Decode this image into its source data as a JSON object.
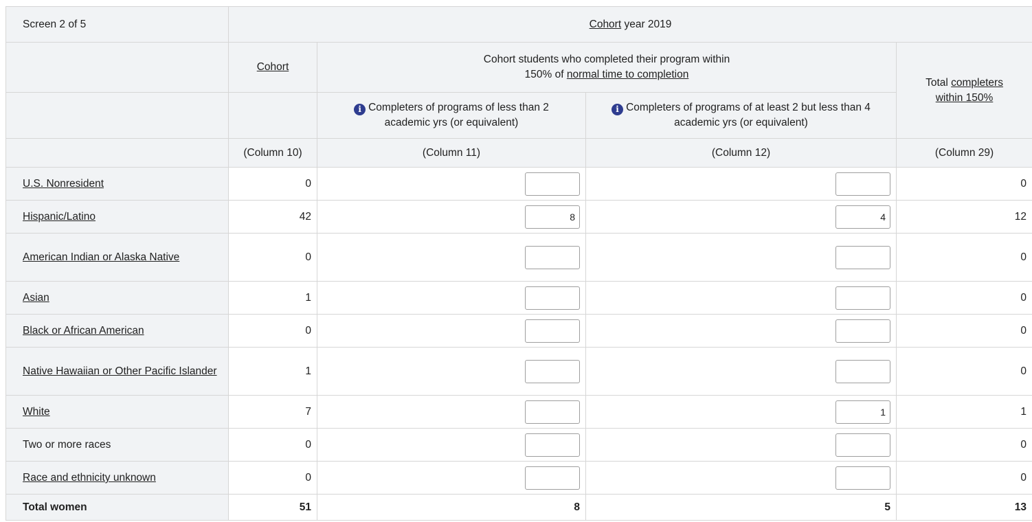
{
  "header": {
    "screen_label": "Screen 2 of 5",
    "cohort_year_link": "Cohort",
    "cohort_year_text": " year 2019",
    "cohort_col": "Cohort",
    "completed_line1": "Cohort students who completed their program within",
    "completed_line2_prefix": "150% of ",
    "completed_line2_link": "normal time to completion",
    "total_prefix": "Total ",
    "total_link_a": "completers",
    "total_link_b": "within 150%",
    "sub_lt2": "Completers of programs of less than 2 academic yrs (or equivalent)",
    "sub_2to4": "Completers of programs of at least 2 but less than 4 academic yrs (or equivalent)",
    "col10": "(Column 10)",
    "col11": "(Column 11)",
    "col12": "(Column 12)",
    "col29": "(Column 29)"
  },
  "rows": [
    {
      "label": "U.S. Nonresident",
      "cohort": "0",
      "c11": "",
      "c12": "",
      "total": "0"
    },
    {
      "label": "Hispanic/Latino",
      "cohort": "42",
      "c11": "8",
      "c12": "4",
      "total": "12"
    },
    {
      "label": "American Indian or Alaska Native",
      "cohort": "0",
      "c11": "",
      "c12": "",
      "total": "0"
    },
    {
      "label": "Asian",
      "cohort": "1",
      "c11": "",
      "c12": "",
      "total": "0"
    },
    {
      "label": "Black or African American",
      "cohort": "0",
      "c11": "",
      "c12": "",
      "total": "0"
    },
    {
      "label": "Native Hawaiian or Other Pacific Islander",
      "cohort": "1",
      "c11": "",
      "c12": "",
      "total": "0"
    },
    {
      "label": "White",
      "cohort": "7",
      "c11": "",
      "c12": "1",
      "total": "1"
    },
    {
      "label": "Two or more races",
      "cohort": "0",
      "c11": "",
      "c12": "",
      "total": "0"
    },
    {
      "label": "Race and ethnicity unknown",
      "cohort": "0",
      "c11": "",
      "c12": "",
      "total": "0"
    }
  ],
  "total_row": {
    "label": "Total women",
    "cohort": "51",
    "c11": "8",
    "c12": "5",
    "total": "13"
  },
  "colors": {
    "header_bg": "#f1f3f5",
    "border": "#d6d6d6",
    "info_icon": "#2e3c8f"
  }
}
